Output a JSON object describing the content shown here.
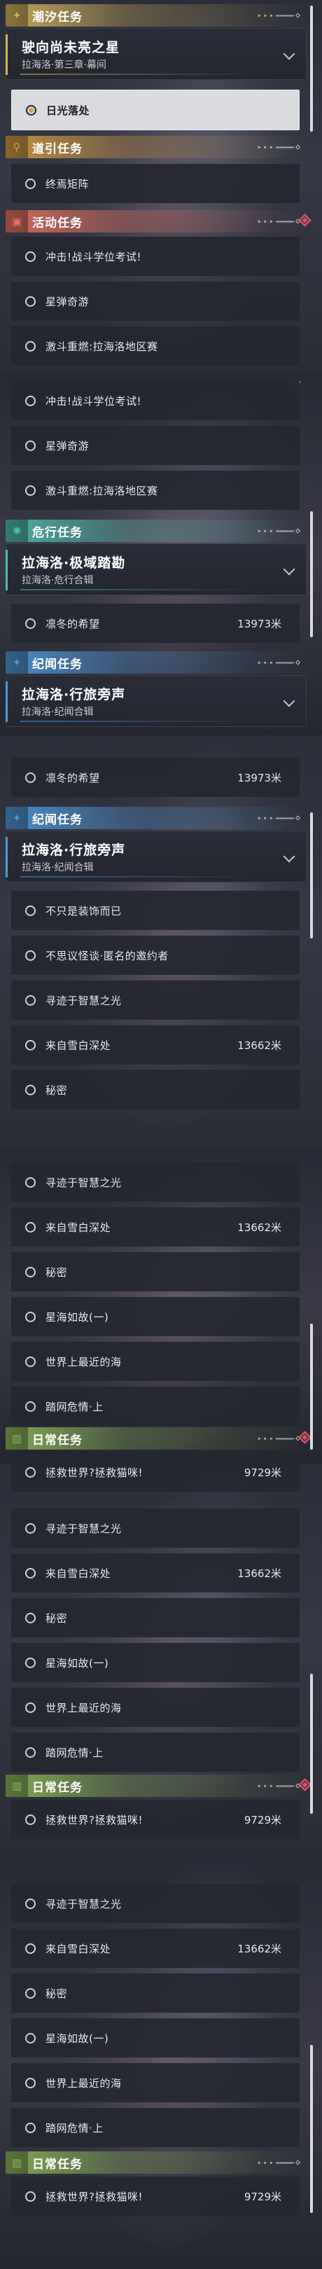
{
  "colors": {
    "tidal": "#d2b25a",
    "guide": "#d39a42",
    "event": "#e5725f",
    "peril": "#4fbcae",
    "chronicle": "#4f98d8",
    "daily": "#8cb45a",
    "alert": "#e0566a",
    "selected_dot": "#d4a23c"
  },
  "icons": {
    "tidal": "sparkle-icon",
    "guide": "map-pin-icon",
    "event": "calendar-icon",
    "peril": "swirl-icon",
    "chronicle": "star-icon",
    "daily": "book-icon"
  },
  "sections": [
    {
      "headers": [
        {
          "kind": "tidal",
          "title": "潮汐任务"
        },
        {
          "kind": "guide",
          "title": "道引任务"
        },
        {
          "kind": "event",
          "title": "活动任务"
        }
      ],
      "card": {
        "title": "驶向尚未亮之星",
        "subtitle": "拉海洛·第三章·幕间"
      },
      "rows": [
        {
          "label": "日光落处",
          "selected": true
        },
        {
          "label": "终焉矩阵"
        },
        {
          "label": "冲击!战斗学位考试!"
        },
        {
          "label": "星弹奇游"
        },
        {
          "label": "激斗重燃:拉海洛地区赛"
        }
      ]
    },
    {
      "headers": [
        {
          "kind": "peril",
          "title": "危行任务"
        },
        {
          "kind": "chronicle",
          "title": "纪闻任务"
        }
      ],
      "cards": [
        {
          "title": "拉海洛·极域踏勘",
          "subtitle": "拉海洛·危行合辑"
        },
        {
          "title": "拉海洛·行旅旁声",
          "subtitle": "拉海洛·纪闻合辑"
        }
      ],
      "rows": [
        {
          "label": "冲击!战斗学位考试!"
        },
        {
          "label": "星弹奇游"
        },
        {
          "label": "激斗重燃:拉海洛地区赛"
        },
        {
          "label": "凛冬的希望",
          "distance": "13973米"
        }
      ]
    },
    {
      "headers": [
        {
          "kind": "chronicle",
          "title": "纪闻任务"
        }
      ],
      "card": {
        "title": "拉海洛·行旅旁声",
        "subtitle": "拉海洛·纪闻合辑"
      },
      "rows": [
        {
          "label": "凛冬的希望",
          "distance": "13973米"
        },
        {
          "label": "不只是装饰而已"
        },
        {
          "label": "不思议怪谈·匿名的邀约者"
        },
        {
          "label": "寻迹于智慧之光"
        },
        {
          "label": "来自雪白深处",
          "distance": "13662米"
        },
        {
          "label": "秘密"
        }
      ]
    },
    {
      "headers": [
        {
          "kind": "daily",
          "title": "日常任务"
        }
      ],
      "rows": [
        {
          "label": "寻迹于智慧之光"
        },
        {
          "label": "来自雪白深处",
          "distance": "13662米"
        },
        {
          "label": "秘密"
        },
        {
          "label": "星海如故(一)"
        },
        {
          "label": "世界上最近的海"
        },
        {
          "label": "踏网危情·上"
        },
        {
          "label": "拯救世界?拯救猫咪!",
          "distance": "9729米"
        }
      ]
    },
    {
      "headers": [
        {
          "kind": "daily",
          "title": "日常任务"
        }
      ],
      "rows": [
        {
          "label": "寻迹于智慧之光"
        },
        {
          "label": "来自雪白深处",
          "distance": "13662米"
        },
        {
          "label": "秘密"
        },
        {
          "label": "星海如故(一)"
        },
        {
          "label": "世界上最近的海"
        },
        {
          "label": "踏网危情·上"
        },
        {
          "label": "拯救世界?拯救猫咪!",
          "distance": "9729米"
        }
      ]
    },
    {
      "headers": [
        {
          "kind": "daily",
          "title": "日常任务"
        }
      ],
      "rows": [
        {
          "label": "寻迹于智慧之光"
        },
        {
          "label": "来自雪白深处",
          "distance": "13662米"
        },
        {
          "label": "秘密"
        },
        {
          "label": "星海如故(一)"
        },
        {
          "label": "世界上最近的海"
        },
        {
          "label": "踏网危情·上"
        },
        {
          "label": "拯救世界?拯救猫咪!",
          "distance": "9729米"
        }
      ]
    }
  ]
}
